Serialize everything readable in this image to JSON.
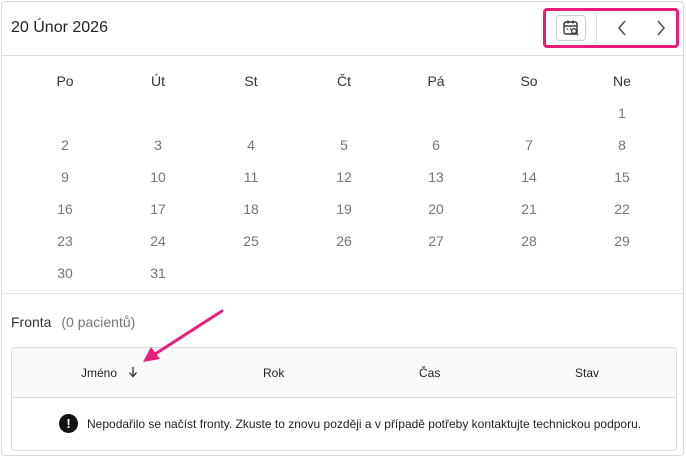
{
  "header": {
    "date_title": "20 Únor 2026",
    "calendar_search_icon": "calendar-search-icon",
    "prev_icon": "chevron-left-icon",
    "next_icon": "chevron-right-icon"
  },
  "calendar": {
    "weekdays": [
      "Po",
      "Út",
      "St",
      "Čt",
      "Pá",
      "So",
      "Ne"
    ],
    "weeks": [
      [
        "",
        "",
        "",
        "",
        "",
        "",
        "1"
      ],
      [
        "2",
        "3",
        "4",
        "5",
        "6",
        "7",
        "8"
      ],
      [
        "9",
        "10",
        "11",
        "12",
        "13",
        "14",
        "15"
      ],
      [
        "16",
        "17",
        "18",
        "19",
        "20",
        "21",
        "22"
      ],
      [
        "23",
        "24",
        "25",
        "26",
        "27",
        "28",
        "29"
      ],
      [
        "30",
        "31",
        "",
        "",
        "",
        "",
        ""
      ]
    ]
  },
  "queue": {
    "title": "Fronta",
    "count": "(0 pacientů)",
    "columns": [
      "Jméno",
      "Rok",
      "Čas",
      "Stav"
    ],
    "sort_icon": "arrow-down-icon",
    "error_icon": "exclamation-icon",
    "error_symbol": "!",
    "error_message": "Nepodařilo se načíst fronty. Zkuste to znovu později a v případě potřeby kontaktujte technickou podporu."
  },
  "colors": {
    "highlight": "#e91e7a",
    "day_text": "#757575"
  }
}
